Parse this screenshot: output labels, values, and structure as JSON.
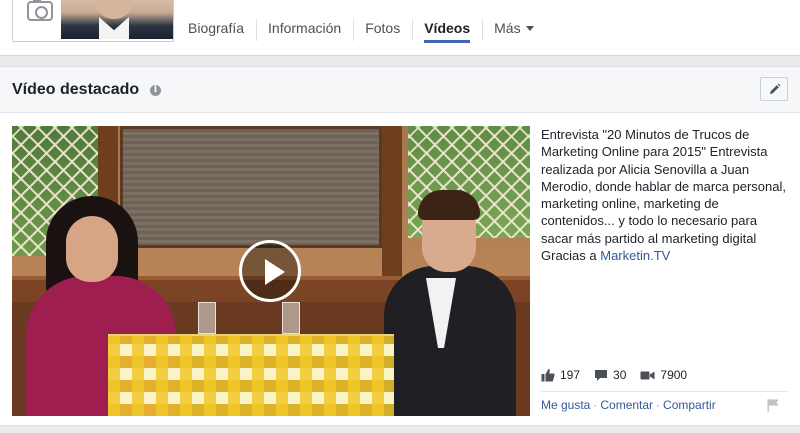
{
  "nav": {
    "tabs": [
      {
        "label": "Biografía"
      },
      {
        "label": "Información"
      },
      {
        "label": "Fotos"
      },
      {
        "label": "Vídeos",
        "active": true
      },
      {
        "label": "Más"
      }
    ]
  },
  "featured": {
    "title": "Vídeo destacado",
    "info_glyph": "i",
    "description": "Entrevista \"20 Minutos de Trucos de Marketing Online para 2015\" Entrevista realizada por Alicia Senovilla a Juan Merodio, donde hablar de marca personal, marketing online, marketing de contenidos... y todo lo necesario para sacar más partido al marketing digital Gracias a ",
    "description_link": "Marketin.TV",
    "stats": {
      "likes": "197",
      "comments": "30",
      "views": "7900"
    },
    "actions": {
      "like": "Me gusta",
      "comment": "Comentar",
      "share": "Compartir",
      "separator": "·"
    }
  },
  "colors": {
    "link": "#365899",
    "accent": "#4267b2",
    "background": "#e9ebee"
  },
  "icons": [
    "camera-icon",
    "info-icon",
    "pencil-icon",
    "play-icon",
    "like-icon",
    "comment-icon",
    "video-camera-icon",
    "flag-icon"
  ]
}
